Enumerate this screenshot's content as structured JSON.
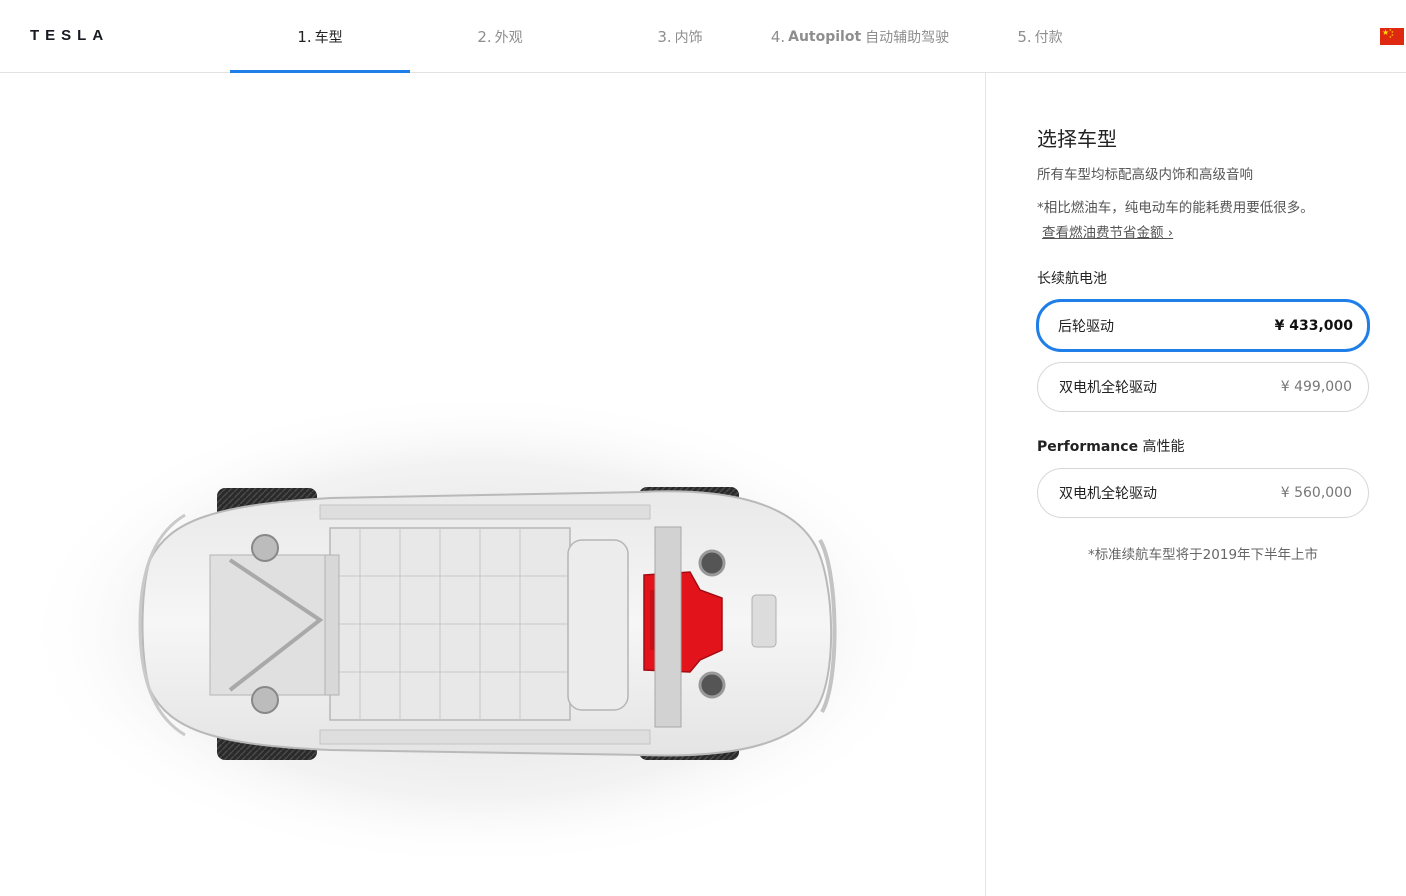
{
  "header": {
    "logo": "TESLA",
    "steps": [
      {
        "num": "1.",
        "strong": "",
        "label": "车型",
        "active": true
      },
      {
        "num": "2.",
        "strong": "",
        "label": "外观",
        "active": false
      },
      {
        "num": "3.",
        "strong": "",
        "label": "内饰",
        "active": false
      },
      {
        "num": "4.",
        "strong": "Autopilot",
        "label": "自动辅助驾驶",
        "active": false
      },
      {
        "num": "5.",
        "strong": "",
        "label": "付款",
        "active": false
      }
    ],
    "region_icon": "china-flag-icon"
  },
  "config": {
    "title": "选择车型",
    "subtitle": "所有车型均标配高级内饰和高级音响",
    "note": "*相比燃油车，纯电动车的能耗费用要低很多。",
    "link": "查看燃油费节省金额 ›",
    "groups": [
      {
        "label_strong": "",
        "label": "长续航电池",
        "options": [
          {
            "name": "后轮驱动",
            "price": "¥ 433,000",
            "selected": true
          },
          {
            "name": "双电机全轮驱动",
            "price": "¥ 499,000",
            "selected": false
          }
        ]
      },
      {
        "label_strong": "Performance",
        "label": " 高性能",
        "options": [
          {
            "name": "双电机全轮驱动",
            "price": "¥ 560,000",
            "selected": false
          }
        ]
      }
    ],
    "footnote": "*标准续航车型将于2019年下半年上市"
  },
  "colors": {
    "accent": "#1f7ee8",
    "motor": "#e3131b"
  }
}
